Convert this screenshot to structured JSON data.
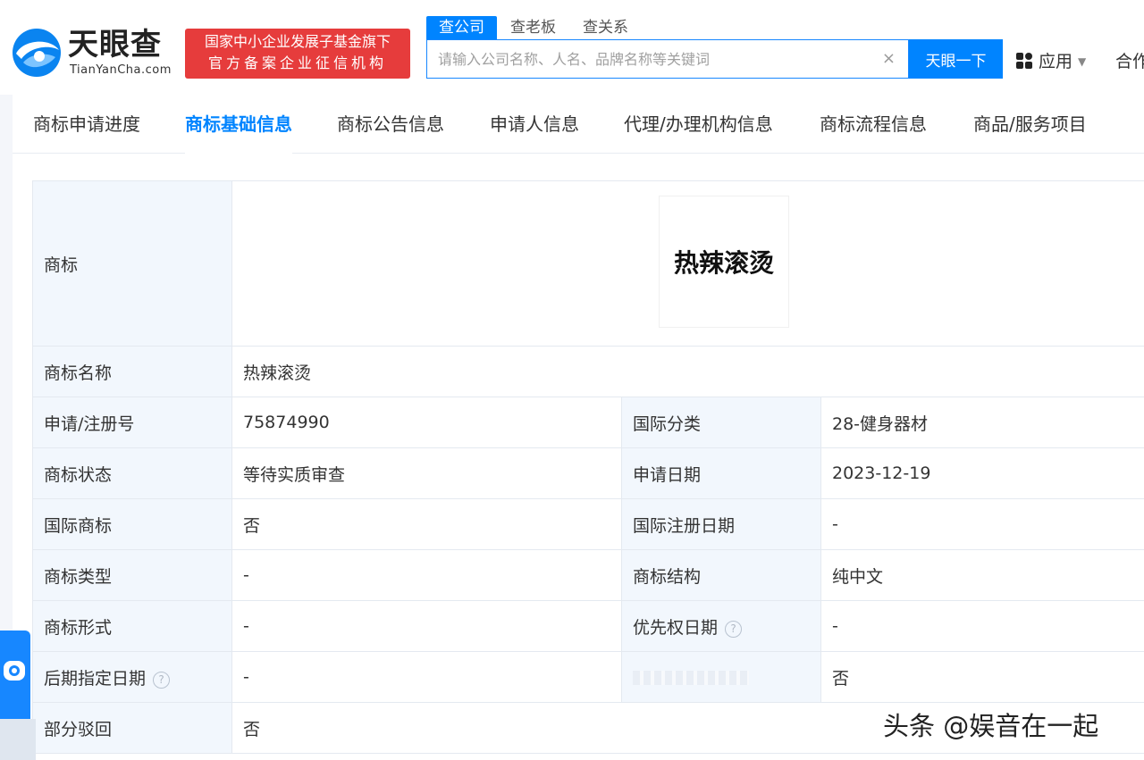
{
  "header": {
    "logo_cn": "天眼查",
    "logo_en": "TianYanCha.com",
    "banner_line1": "国家中小企业发展子基金旗下",
    "banner_line2": "官方备案企业征信机构",
    "search_tabs": [
      {
        "label": "查公司",
        "active": true
      },
      {
        "label": "查老板",
        "active": false
      },
      {
        "label": "查关系",
        "active": false
      }
    ],
    "search_placeholder": "请输入公司名称、人名、品牌名称等关键词",
    "search_button": "天眼一下",
    "apps_label": "应用",
    "more_label": "合作"
  },
  "tabs": [
    {
      "label": "商标申请进度",
      "active": false
    },
    {
      "label": "商标基础信息",
      "active": true
    },
    {
      "label": "商标公告信息",
      "active": false
    },
    {
      "label": "申请人信息",
      "active": false
    },
    {
      "label": "代理/办理机构信息",
      "active": false
    },
    {
      "label": "商标流程信息",
      "active": false
    },
    {
      "label": "商品/服务项目",
      "active": false
    }
  ],
  "trademark": {
    "image_label": "商标",
    "image_text": "热辣滚烫",
    "name_label": "商标名称",
    "name_value": "热辣滚烫",
    "rows": [
      {
        "l1": "申请/注册号",
        "v1": "75874990",
        "l2": "国际分类",
        "v2": "28-健身器材"
      },
      {
        "l1": "商标状态",
        "v1": "等待实质审查",
        "l2": "申请日期",
        "v2": "2023-12-19"
      },
      {
        "l1": "国际商标",
        "v1": "否",
        "l2": "国际注册日期",
        "v2": "-"
      },
      {
        "l1": "商标类型",
        "v1": "-",
        "l2": "商标结构",
        "v2": "纯中文"
      },
      {
        "l1": "商标形式",
        "v1": "-",
        "l2": "优先权日期",
        "v2": "-"
      },
      {
        "l1": "后期指定日期",
        "v1": "-",
        "l2": "",
        "v2": "否"
      }
    ],
    "last_label": "部分驳回",
    "last_value": "否"
  },
  "watermark": "头条 @娱音在一起",
  "colors": {
    "accent": "#0084ff",
    "banner": "#e63c3c",
    "label_bg": "#f2f7fd"
  }
}
